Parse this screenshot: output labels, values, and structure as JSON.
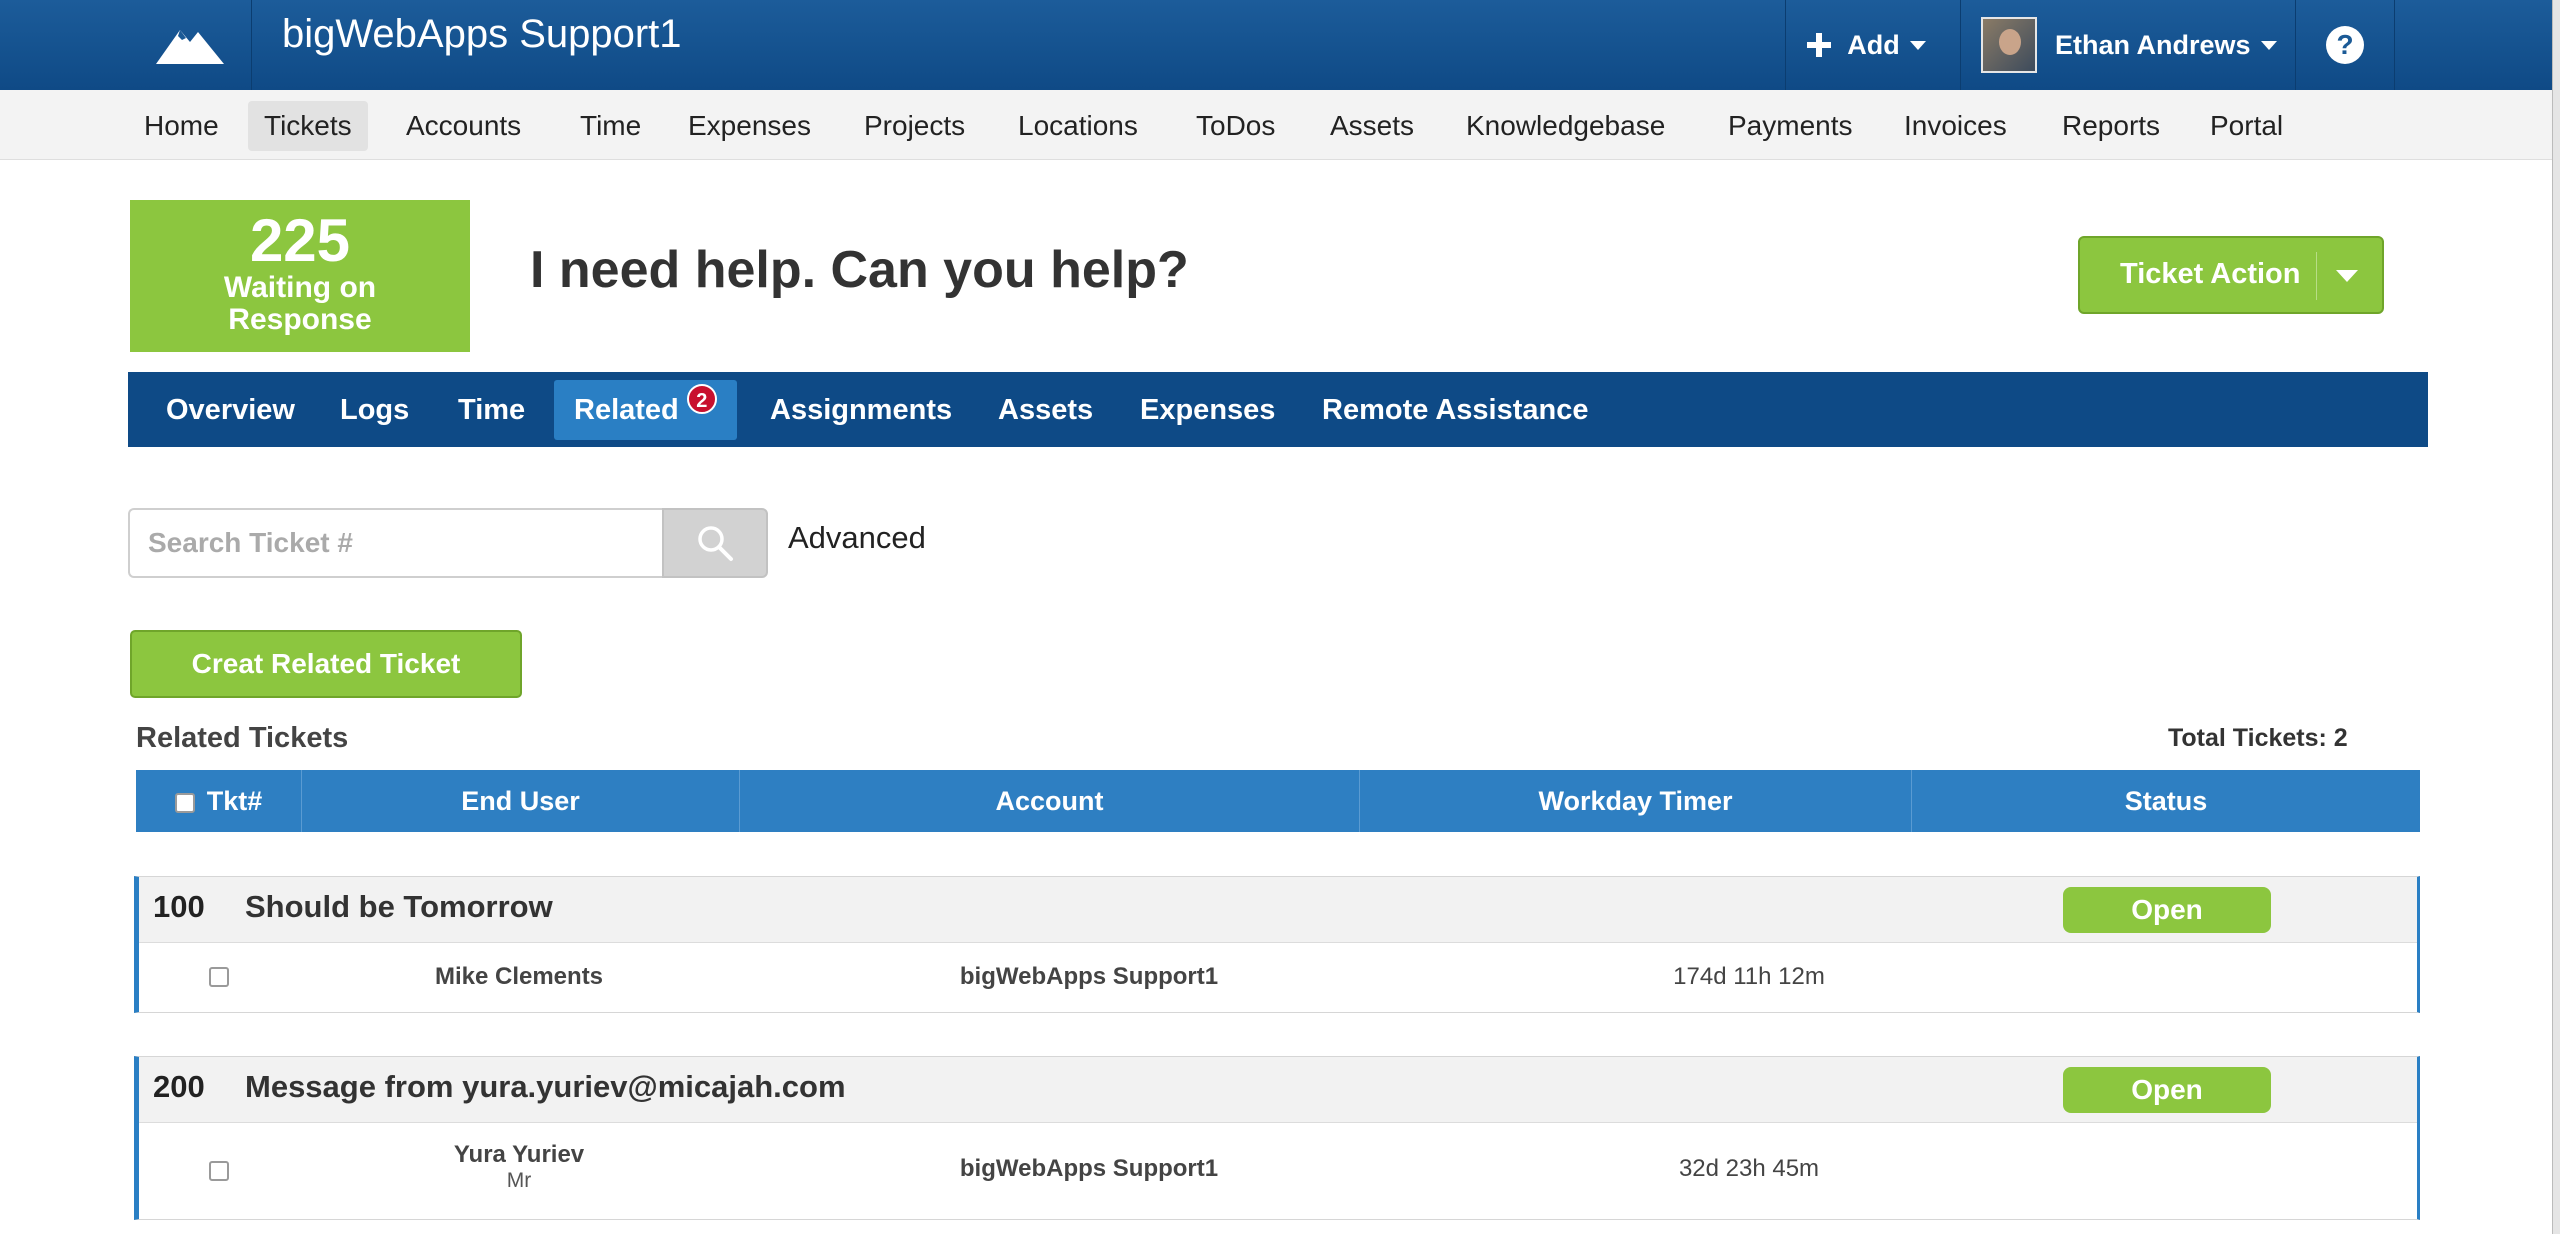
{
  "app": {
    "title": "bigWebApps Support1",
    "logo_icon": "mountain-logo-icon",
    "add_label": "Add",
    "user_name": "Ethan Andrews",
    "help_glyph": "?"
  },
  "nav": {
    "items": [
      "Home",
      "Tickets",
      "Accounts",
      "Time",
      "Expenses",
      "Projects",
      "Locations",
      "ToDos",
      "Assets",
      "Knowledgebase",
      "Payments",
      "Invoices",
      "Reports",
      "Portal"
    ],
    "active": "Tickets"
  },
  "ticket": {
    "waiting_count": "225",
    "waiting_label_1": "Waiting on",
    "waiting_label_2": "Response",
    "subject": "I need help. Can you help?",
    "action_label": "Ticket Action"
  },
  "tabs": {
    "items": [
      "Overview",
      "Logs",
      "Time",
      "Related",
      "Assignments",
      "Assets",
      "Expenses",
      "Remote Assistance"
    ],
    "active": "Related",
    "related_badge": "2"
  },
  "search": {
    "placeholder": "Search Ticket #",
    "advanced_label": "Advanced"
  },
  "related": {
    "create_label": "Creat Related Ticket",
    "section_title": "Related Tickets",
    "total_label": "Total Tickets: 2",
    "columns": [
      "Tkt#",
      "End User",
      "Account",
      "Workday Timer",
      "Status"
    ],
    "rows": [
      {
        "number": "100",
        "subject": "Should be Tomorrow",
        "status": "Open",
        "end_user": "Mike Clements",
        "end_user_title": "",
        "account": "bigWebApps Support1",
        "timer": "174d 11h 12m"
      },
      {
        "number": "200",
        "subject": "Message from yura.yuriev@micajah.com",
        "status": "Open",
        "end_user": "Yura Yuriev",
        "end_user_title": "Mr",
        "account": "bigWebApps Support1",
        "timer": "32d 23h 45m"
      }
    ]
  },
  "colors": {
    "topbar": "#1c5c9a",
    "tabbar": "#0e4a86",
    "accent_green": "#8cc63f",
    "table_header": "#2e7fc2",
    "badge_red": "#c8102e"
  }
}
